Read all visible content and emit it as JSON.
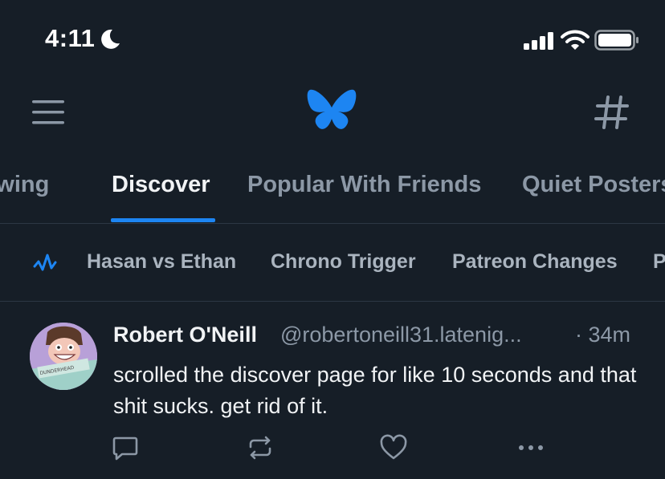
{
  "status_bar": {
    "time": "4:11"
  },
  "header": {
    "menu_icon": "hamburger-menu-icon",
    "logo": "bluesky-butterfly-logo",
    "feeds_icon": "hashtag-icon",
    "accent_color": "#1d85f2"
  },
  "tabs": [
    {
      "label": "Following",
      "active": false
    },
    {
      "label": "Discover",
      "active": true
    },
    {
      "label": "Popular With Friends",
      "active": false
    },
    {
      "label": "Quiet Posters",
      "active": false
    }
  ],
  "trending": {
    "icon": "trending-icon",
    "topics": [
      "Hasan vs Ethan",
      "Chrono Trigger",
      "Patreon Changes",
      "P"
    ]
  },
  "post": {
    "author_name": "Robert O'Neill",
    "author_handle": "@robertoneill31.latenig...",
    "timestamp": "· 34m",
    "text": "scrolled the discover page for like 10 seconds and that shit sucks. get rid of it.",
    "avatar_caption": "DUNDERHEAD"
  }
}
